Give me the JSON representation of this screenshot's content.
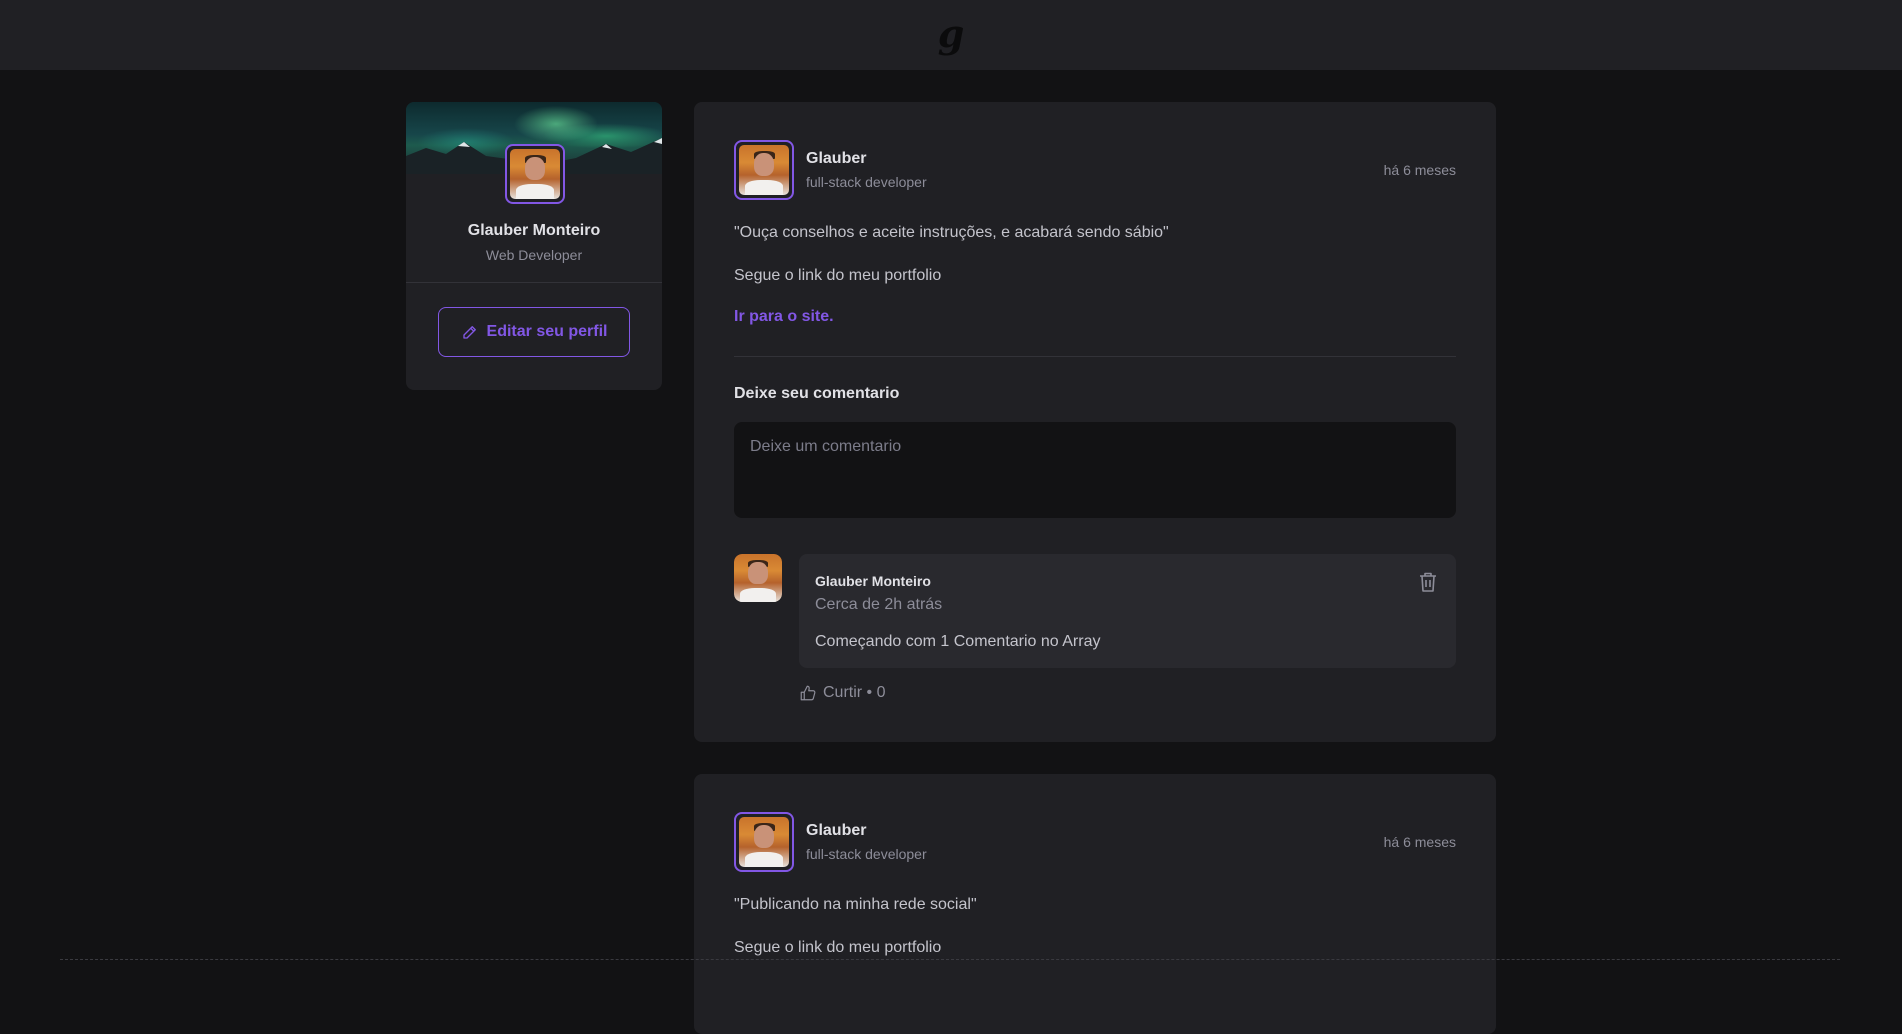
{
  "header": {
    "logo": "g"
  },
  "sidebar": {
    "name": "Glauber Monteiro",
    "role": "Web Developer",
    "edit_label": "Editar seu perfil"
  },
  "posts": [
    {
      "author": "Glauber",
      "author_role": "full-stack developer",
      "time": "há 6 meses",
      "quote": "\"Ouça conselhos e aceite instruções, e acabará sendo sábio\"",
      "text": "Segue o link do meu portfolio",
      "link": "Ir para o site.",
      "comment_title": "Deixe seu comentario",
      "comment_placeholder": "Deixe um comentario",
      "comments": [
        {
          "author": "Glauber Monteiro",
          "time": "Cerca de 2h atrás",
          "text": "Começando com 1 Comentario no Array",
          "like_label": "Curtir • 0"
        }
      ]
    },
    {
      "author": "Glauber",
      "author_role": "full-stack developer",
      "time": "há 6 meses",
      "quote": "\"Publicando na minha rede social\"",
      "text": "Segue o link do meu portfolio"
    }
  ],
  "colors": {
    "accent": "#8257e5",
    "background": "#121214",
    "card": "#202024"
  },
  "icons": {
    "edit": "pencil-icon",
    "delete": "trash-icon",
    "like": "thumbs-up-icon"
  }
}
